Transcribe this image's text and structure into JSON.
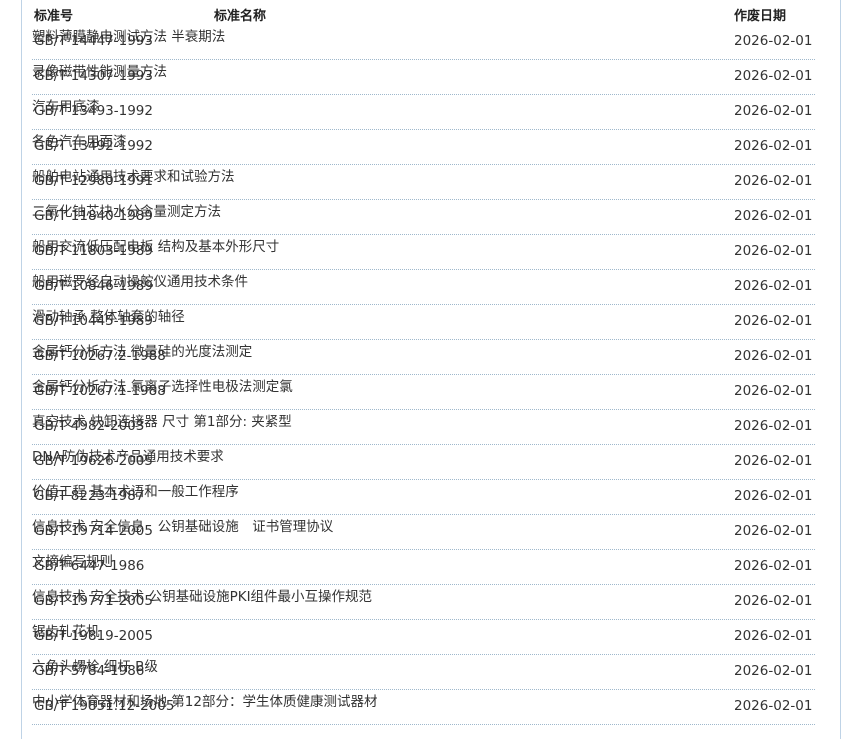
{
  "header": {
    "code": "标准号",
    "name": "标准名称",
    "date": "作废日期"
  },
  "rows": [
    {
      "code": "GB/T 14447-1993",
      "name": "塑料薄膜静电测试方法 半衰期法",
      "date": "2026-02-01"
    },
    {
      "code": "GB/T 14307-1993",
      "name": "录像磁带性能测量方法",
      "date": "2026-02-01"
    },
    {
      "code": "GB/T 13493-1992",
      "name": "汽车用底漆",
      "date": "2026-02-01"
    },
    {
      "code": "GB/T 13492-1992",
      "name": "各色汽车用面漆",
      "date": "2026-02-01"
    },
    {
      "code": "GB/T 12980-1991",
      "name": "船舶电站通用技术要求和试验方法",
      "date": "2026-02-01"
    },
    {
      "code": "GB/T 11840-1989",
      "name": "二氧化铀芯块水分含量测定方法",
      "date": "2026-02-01"
    },
    {
      "code": "GB/T 11803-1989",
      "name": "船用交流低压配电板 结构及基本外形尺寸",
      "date": "2026-02-01"
    },
    {
      "code": "GB/T 10846-1989",
      "name": "船用磁罗经自动操舵仪通用技术条件",
      "date": "2026-02-01"
    },
    {
      "code": "GB/T 10445-1989",
      "name": "滑动轴承 整体轴套的轴径",
      "date": "2026-02-01"
    },
    {
      "code": "GB/T 10267.2-1988",
      "name": "金属钙分析方法 微量硅的光度法测定",
      "date": "2026-02-01"
    },
    {
      "code": "GB/T 10267.1-1988",
      "name": "金属钙分析方法 氯离子选择性电极法测定氯",
      "date": "2026-02-01"
    },
    {
      "code": "GB/T 4982-2003",
      "name": "真空技术 快卸连接器 尺寸 第1部分: 夹紧型",
      "date": "2026-02-01"
    },
    {
      "code": "GB/T 19626-2005",
      "name": "DNA防伪技术产品通用技术要求",
      "date": "2026-02-01"
    },
    {
      "code": "GB/T 8223-1987",
      "name": "价值工程 基本术语和一般工作程序",
      "date": "2026-02-01"
    },
    {
      "code": "GB/T 19714-2005",
      "name": "信息技术 安全信息　公钥基础设施　证书管理协议",
      "date": "2026-02-01"
    },
    {
      "code": "GB/T 6447-1986",
      "name": "文摘编写规则",
      "date": "2026-02-01"
    },
    {
      "code": "GB/T 19771-2005",
      "name": "信息技术 安全技术 公钥基础设施PKI组件最小互操作规范",
      "date": "2026-02-01"
    },
    {
      "code": "GB/T 19819-2005",
      "name": "锯齿轧花机",
      "date": "2026-02-01"
    },
    {
      "code": "GB/T 5784-1986",
      "name": "六角头螺栓 细杆 B级",
      "date": "2026-02-01"
    },
    {
      "code": "GB/T 19851.12-2005",
      "name": "中小学体育器材和场地 第12部分：学生体质健康测试器材",
      "date": "2026-02-01"
    }
  ]
}
